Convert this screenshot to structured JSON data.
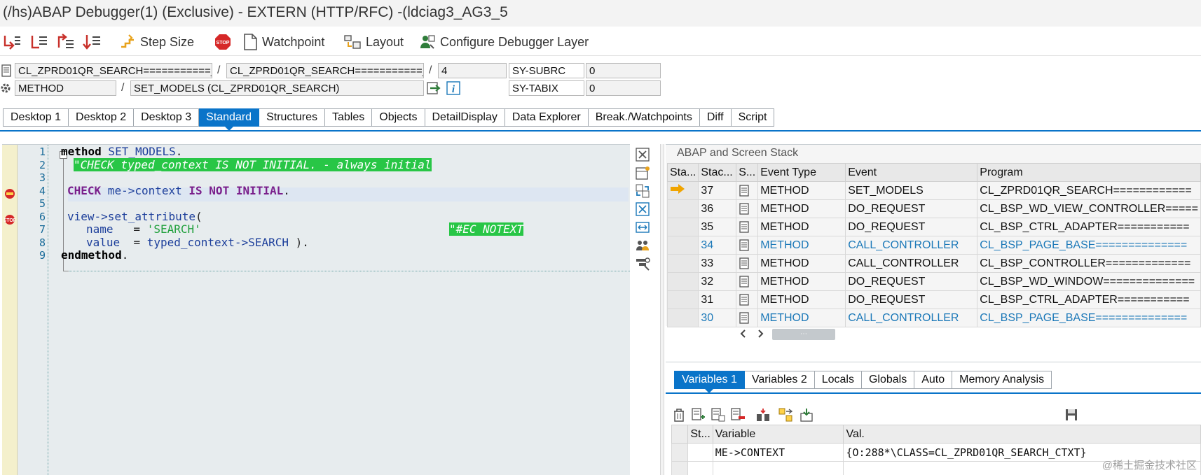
{
  "window": {
    "title": "(/hs)ABAP Debugger(1)  (Exclusive) - EXTERN (HTTP/RFC) -(ldciag3_AG3_5"
  },
  "toolbar": {
    "step_size_label": "Step Size",
    "watchpoint_label": "Watchpoint",
    "layout_label": "Layout",
    "configure_label": "Configure Debugger Layer"
  },
  "info": {
    "program": "CL_ZPRD01QR_SEARCH===========_",
    "include": "CL_ZPRD01QR_SEARCH===========_",
    "line": "4",
    "sy_subrc_label": "SY-SUBRC",
    "sy_subrc_value": "0",
    "event_type": "METHOD",
    "event": "SET_MODELS (CL_ZPRD01QR_SEARCH)",
    "sy_tabix_label": "SY-TABIX",
    "sy_tabix_value": "0"
  },
  "desktop_tabs": [
    "Desktop 1",
    "Desktop 2",
    "Desktop 3",
    "Standard",
    "Structures",
    "Tables",
    "Objects",
    "DetailDisplay",
    "Data Explorer",
    "Break./Watchpoints",
    "Diff",
    "Script"
  ],
  "active_desktop_tab": "Standard",
  "code": {
    "line_numbers": [
      "1",
      "2",
      "3",
      "4",
      "5",
      "6",
      "7",
      "8",
      "9"
    ],
    "lines": [
      {
        "parts": [
          [
            "kw",
            "method"
          ],
          [
            "id",
            " SET_MODELS"
          ],
          [
            "",
            "."
          ]
        ]
      },
      {
        "parts": [
          [
            "cm",
            "\"CHECK typed_context IS NOT INITIAL. - always initial"
          ]
        ]
      },
      {
        "parts": []
      },
      {
        "parts": [
          [
            "kw2",
            "CHECK"
          ],
          [
            "id",
            " me->context"
          ],
          [
            "kw2",
            " IS NOT INITIAL"
          ],
          [
            "",
            "."
          ]
        ]
      },
      {
        "parts": []
      },
      {
        "parts": [
          [
            "id",
            "view->set_attribute"
          ],
          [
            "",
            "("
          ]
        ]
      },
      {
        "parts": [
          [
            "id",
            "name"
          ],
          [
            "",
            "   = "
          ],
          [
            "str",
            "'SEARCH'"
          ]
        ]
      },
      {
        "parts": [
          [
            "id",
            "value"
          ],
          [
            "",
            "  = "
          ],
          [
            "id",
            "typed_context->SEARCH"
          ],
          [
            "",
            " )."
          ]
        ]
      },
      {
        "parts": [
          [
            "kw",
            "endmethod"
          ],
          [
            "",
            "."
          ]
        ]
      }
    ],
    "line7_pragma": "\"#EC NOTEXT"
  },
  "stack": {
    "title": "ABAP and Screen Stack",
    "columns": [
      "Sta...",
      "Stac...",
      "S...",
      "Event Type",
      "Event",
      "Program"
    ],
    "rows": [
      {
        "level": "37",
        "type": "METHOD",
        "event": "SET_MODELS",
        "program": "CL_ZPRD01QR_SEARCH============",
        "current": true,
        "link": false
      },
      {
        "level": "36",
        "type": "METHOD",
        "event": "DO_REQUEST",
        "program": "CL_BSP_WD_VIEW_CONTROLLER=====",
        "current": false,
        "link": false
      },
      {
        "level": "35",
        "type": "METHOD",
        "event": "DO_REQUEST",
        "program": "CL_BSP_CTRL_ADAPTER===========",
        "current": false,
        "link": false
      },
      {
        "level": "34",
        "type": "METHOD",
        "event": "CALL_CONTROLLER",
        "program": "CL_BSP_PAGE_BASE==============",
        "current": false,
        "link": true
      },
      {
        "level": "33",
        "type": "METHOD",
        "event": "CALL_CONTROLLER",
        "program": "CL_BSP_CONTROLLER=============",
        "current": false,
        "link": false
      },
      {
        "level": "32",
        "type": "METHOD",
        "event": "DO_REQUEST",
        "program": "CL_BSP_WD_WINDOW==============",
        "current": false,
        "link": false
      },
      {
        "level": "31",
        "type": "METHOD",
        "event": "DO_REQUEST",
        "program": "CL_BSP_CTRL_ADAPTER===========",
        "current": false,
        "link": false
      },
      {
        "level": "30",
        "type": "METHOD",
        "event": "CALL_CONTROLLER",
        "program": "CL_BSP_PAGE_BASE==============",
        "current": false,
        "link": true
      }
    ]
  },
  "variable_tabs": [
    "Variables 1",
    "Variables 2",
    "Locals",
    "Globals",
    "Auto",
    "Memory Analysis"
  ],
  "active_variable_tab": "Variables 1",
  "variables": {
    "columns": [
      "St...",
      "Variable",
      "Val."
    ],
    "rows": [
      {
        "variable": "ME->CONTEXT",
        "value": "{O:288*\\CLASS=CL_ZPRD01QR_SEARCH_CTXT}"
      }
    ]
  },
  "watermark": "@稀土掘金技术社区",
  "colors": {
    "accent": "#0a74c9",
    "comment_bg": "#28c646",
    "link": "#1b78b8",
    "breakpoint_gutter": "#f4f0cc"
  }
}
